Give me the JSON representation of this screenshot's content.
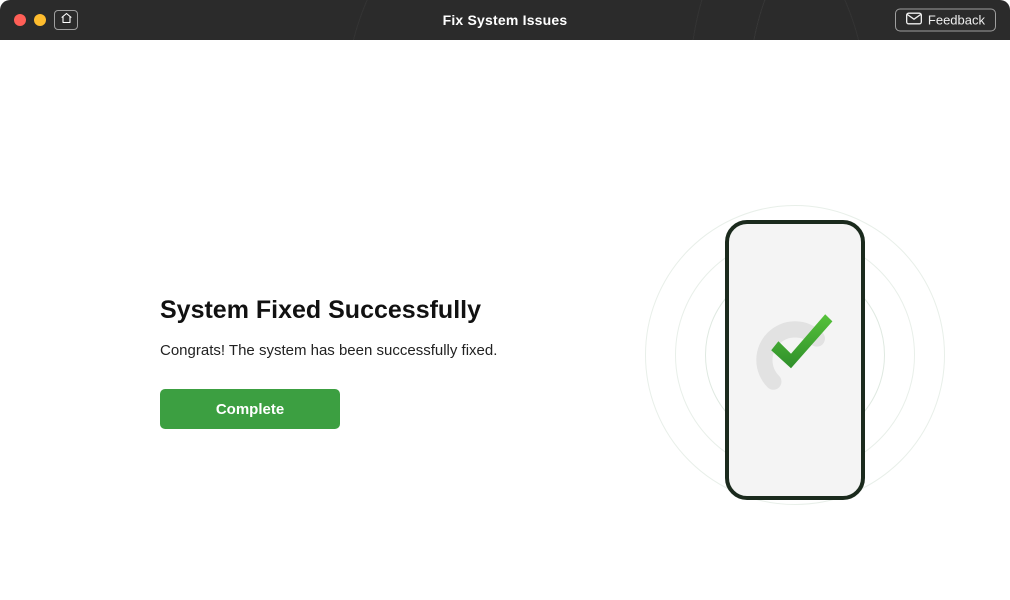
{
  "titlebar": {
    "title": "Fix System Issues",
    "feedback_label": "Feedback"
  },
  "main": {
    "heading": "System Fixed Successfully",
    "subtext": "Congrats! The system has been successfully fixed.",
    "complete_label": "Complete"
  },
  "colors": {
    "accent_green": "#3c9f41",
    "titlebar_bg": "#2b2b2b"
  }
}
